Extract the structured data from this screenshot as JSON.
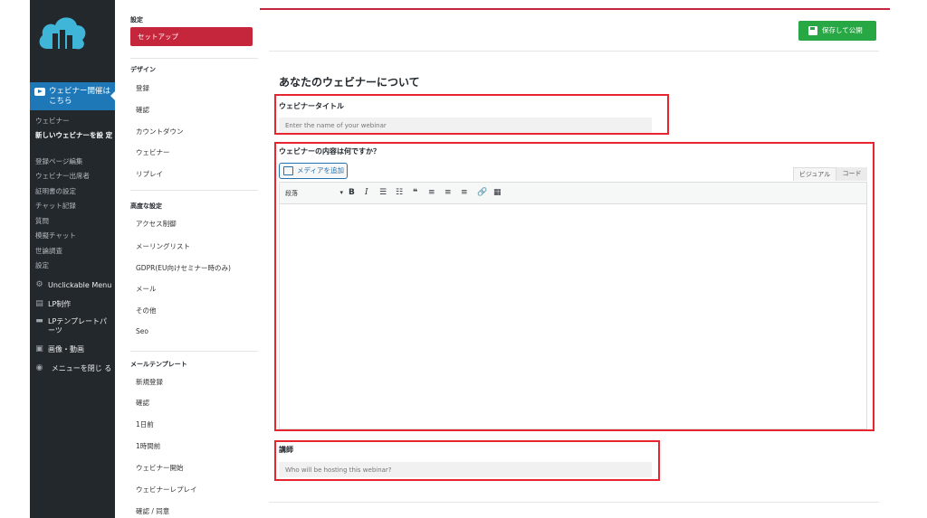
{
  "sidebar": {
    "active_item": "ウェビナー開催は こちら",
    "submenu": [
      {
        "label": "ウェビナー",
        "current": false
      },
      {
        "label": "新しいウェビナーを設 定",
        "current": true
      },
      {
        "label": "登録ページ編集",
        "current": false
      },
      {
        "label": "ウェビナー出席者",
        "current": false
      },
      {
        "label": "証明書の設定",
        "current": false
      },
      {
        "label": "チャット記録",
        "current": false
      },
      {
        "label": "質問",
        "current": false
      },
      {
        "label": "模擬チャット",
        "current": false
      },
      {
        "label": "世論調査",
        "current": false
      },
      {
        "label": "設定",
        "current": false
      }
    ],
    "menu": [
      {
        "label": "Unclickable Menu",
        "icon": "gear-icon"
      },
      {
        "label": "LP制作",
        "icon": "pages-icon"
      },
      {
        "label": "LPテンプレートパ ーツ",
        "icon": "folder-icon"
      },
      {
        "label": "画像・動画",
        "icon": "media-icon"
      },
      {
        "label": "メニューを閉じ る",
        "icon": "collapse-icon"
      }
    ]
  },
  "settings_nav": {
    "sections": [
      {
        "heading": "設定",
        "items": [
          "セットアップ"
        ],
        "active": "セットアップ"
      },
      {
        "heading": "デザイン",
        "items": [
          "登録",
          "確認",
          "カウントダウン",
          "ウェビナー",
          "リプレイ"
        ]
      },
      {
        "heading": "高度な設定",
        "items": [
          "アクセス制御",
          "メーリングリスト",
          "GDPR(EU向けセミナー時のみ)",
          "メール",
          "その他",
          "Seo"
        ]
      },
      {
        "heading": "メールテンプレート",
        "items": [
          "新規登録",
          "確認",
          "1日前",
          "1時間前",
          "ウェビナー開始",
          "ウェビナーレプレイ",
          "確認 / 同意"
        ]
      }
    ]
  },
  "header": {
    "save_label": "保存して公開"
  },
  "main": {
    "title": "あなたのウェビナーについて",
    "webinar_title": {
      "label": "ウェビナータイトル",
      "placeholder": "Enter the name of your webinar",
      "value": ""
    },
    "content": {
      "label": "ウェビナーの内容は何ですか？",
      "add_media_label": "メディアを追加",
      "tabs": [
        "ビジュアル",
        "コード"
      ],
      "format_value": "段落",
      "toolbar": [
        "B",
        "I",
        "bulleted-list-icon",
        "numbered-list-icon",
        "blockquote-icon",
        "align-left-icon",
        "align-center-icon",
        "align-right-icon",
        "link-icon",
        "toolbar-toggle-icon"
      ]
    },
    "host": {
      "label": "講師",
      "placeholder": "Who will be hosting this webinar?",
      "value": ""
    }
  },
  "colors": {
    "accent": "#c5263b",
    "sidebar_bg": "#23282d",
    "active_blue": "#1e78b8",
    "save_green": "#28a745",
    "highlight_red": "#e8242f"
  }
}
